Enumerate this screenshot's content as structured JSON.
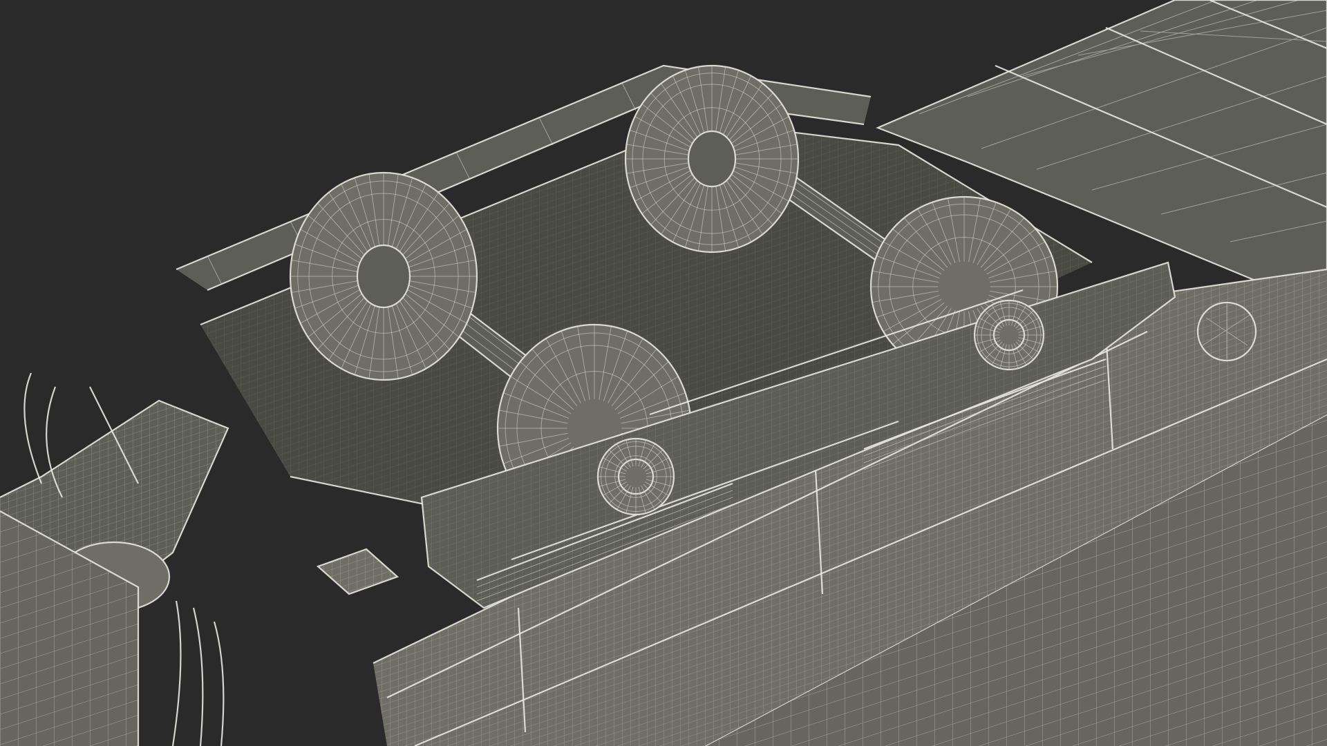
{
  "viewport": {
    "background_color": "#2a2a2a",
    "surface_color": "#5e5e58",
    "wire_color": "#d8d8cf"
  }
}
